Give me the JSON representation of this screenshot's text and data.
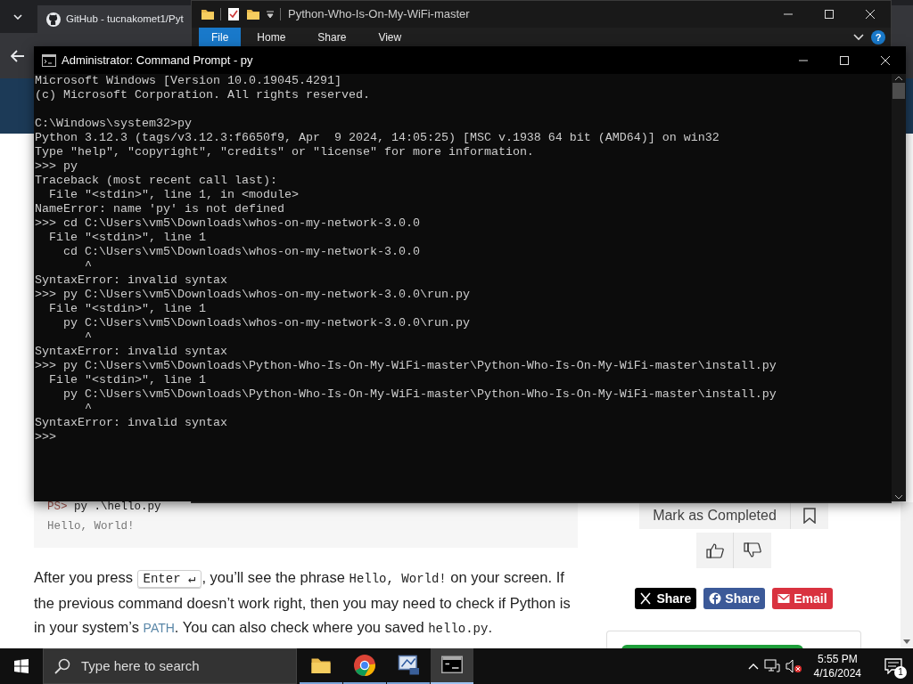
{
  "browser": {
    "tab_title": "GitHub - tucnakomet1/Pyt",
    "code_block": [
      {
        "prompt": "PS>",
        "text": " py .\\hello.py"
      },
      {
        "text": "Hello, World!"
      }
    ],
    "paragraph": [
      {
        "kind": "text",
        "text": "After you press "
      },
      {
        "kind": "key",
        "text": "Enter ↵"
      },
      {
        "kind": "text",
        "text": ", you’ll see the phrase "
      },
      {
        "kind": "code",
        "text": "Hello, World!"
      },
      {
        "kind": "text",
        "text": " on your screen. If the previous command doesn’t work right, then you may need to check if Python is in your system’s "
      },
      {
        "kind": "abbr",
        "text": "PATH"
      },
      {
        "kind": "text",
        "text": ". You can also check where you saved "
      },
      {
        "kind": "code",
        "text": "hello.py"
      },
      {
        "kind": "text",
        "text": "."
      }
    ],
    "mark_button": "Mark as Completed",
    "share_buttons": [
      {
        "kind": "x",
        "label": "Share"
      },
      {
        "kind": "facebook",
        "label": "Share"
      },
      {
        "kind": "email",
        "label": "Email"
      }
    ]
  },
  "explorer": {
    "title": "Python-Who-Is-On-My-WiFi-master",
    "ribbon_tabs": [
      {
        "label": "File",
        "selected": true
      },
      {
        "label": "Home",
        "selected": false
      },
      {
        "label": "Share",
        "selected": false
      },
      {
        "label": "View",
        "selected": false
      }
    ],
    "help": "?"
  },
  "console": {
    "title": "Administrator: Command Prompt - py",
    "blocks": [
      [
        "Microsoft Windows [Version 10.0.19045.4291]",
        "(c) Microsoft Corporation. All rights reserved."
      ],
      [
        "C:\\Windows\\system32>py",
        "Python 3.12.3 (tags/v3.12.3:f6650f9, Apr  9 2024, 14:05:25) [MSC v.1938 64 bit (AMD64)] on win32",
        "Type \"help\", \"copyright\", \"credits\" or \"license\" for more information.",
        ">>> py",
        "Traceback (most recent call last):",
        "  File \"<stdin>\", line 1, in <module>",
        "NameError: name 'py' is not defined",
        ">>> cd C:\\Users\\vm5\\Downloads\\whos-on-my-network-3.0.0",
        "  File \"<stdin>\", line 1",
        "    cd C:\\Users\\vm5\\Downloads\\whos-on-my-network-3.0.0",
        "       ^",
        "SyntaxError: invalid syntax",
        ">>> py C:\\Users\\vm5\\Downloads\\whos-on-my-network-3.0.0\\run.py",
        "  File \"<stdin>\", line 1",
        "    py C:\\Users\\vm5\\Downloads\\whos-on-my-network-3.0.0\\run.py",
        "       ^",
        "SyntaxError: invalid syntax",
        ">>> py C:\\Users\\vm5\\Downloads\\Python-Who-Is-On-My-WiFi-master\\Python-Who-Is-On-My-WiFi-master\\install.py",
        "  File \"<stdin>\", line 1",
        "    py C:\\Users\\vm5\\Downloads\\Python-Who-Is-On-My-WiFi-master\\Python-Who-Is-On-My-WiFi-master\\install.py",
        "       ^",
        "SyntaxError: invalid syntax",
        ">>>"
      ]
    ]
  },
  "taskbar": {
    "search_placeholder": "Type here to search",
    "apps": [
      {
        "kind": "folder",
        "active": false
      },
      {
        "kind": "browser",
        "active": false
      },
      {
        "kind": "monitor",
        "active": false
      },
      {
        "kind": "terminal",
        "active": true
      }
    ],
    "time": "5:55 PM",
    "date": "4/16/2024",
    "notifications": "1"
  }
}
